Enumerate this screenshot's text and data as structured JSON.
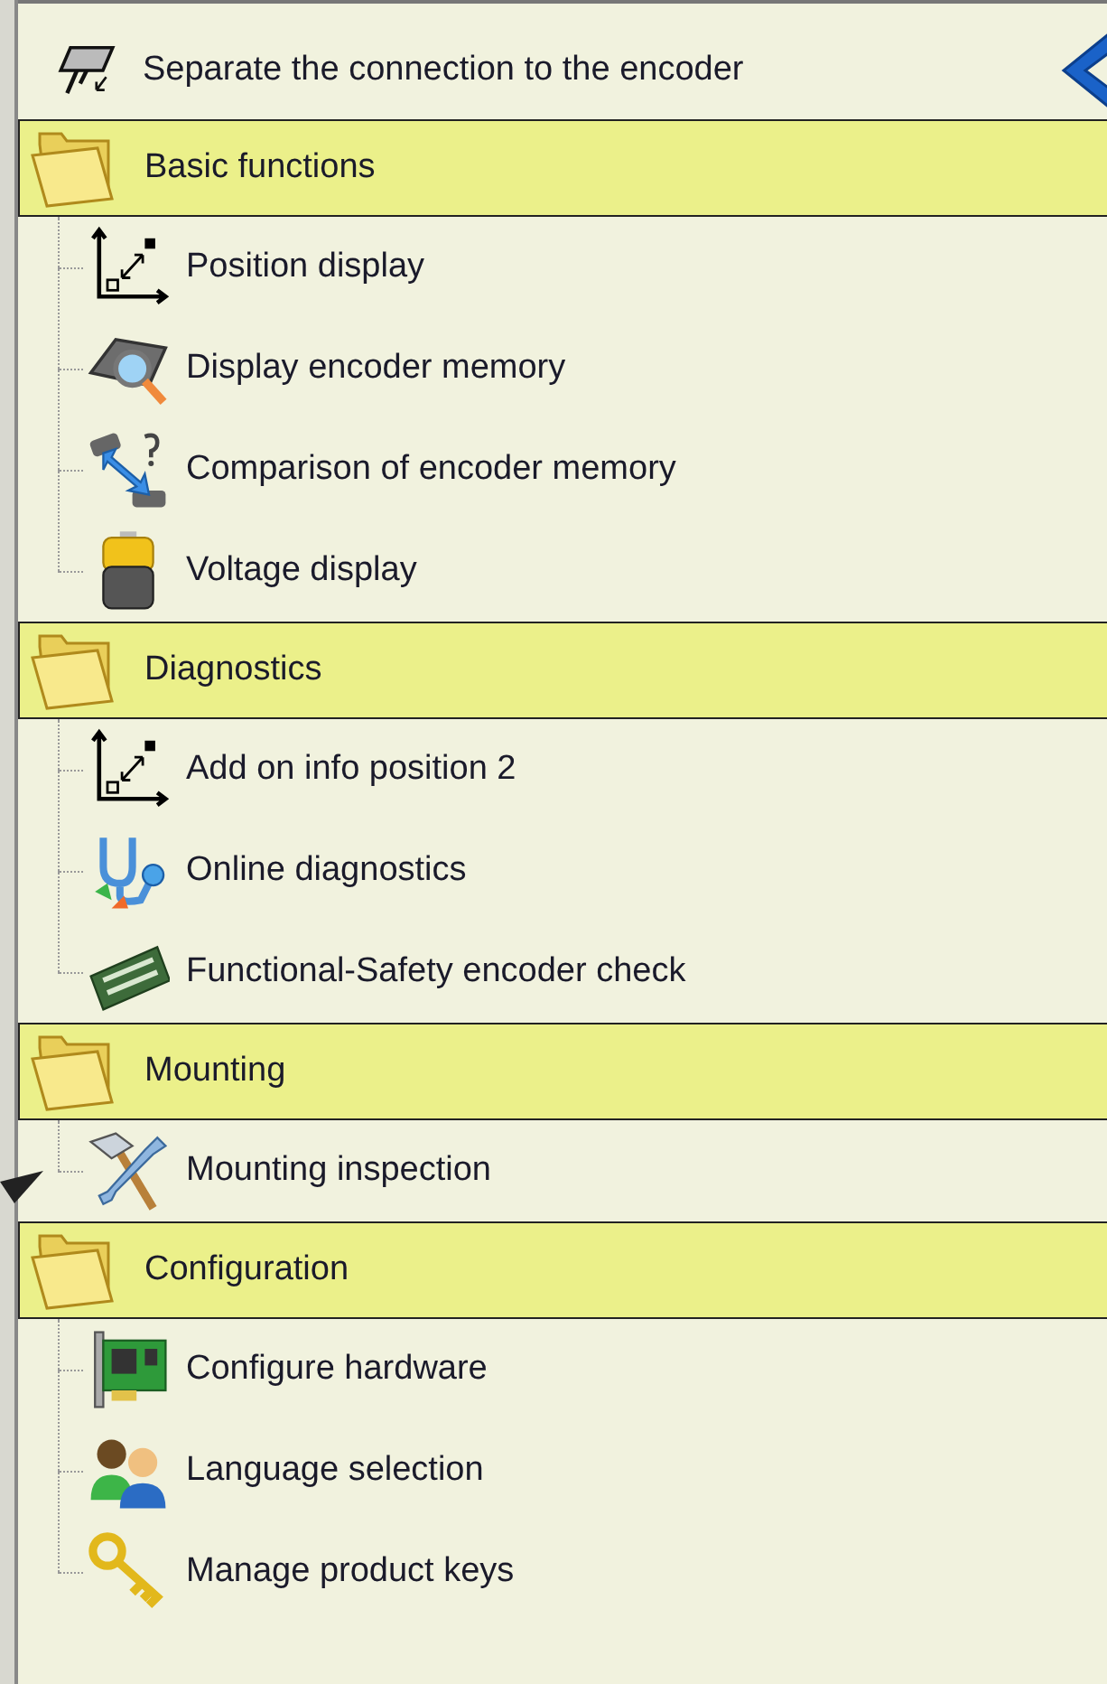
{
  "top_action": {
    "label": "Separate the connection to the encoder"
  },
  "groups": [
    {
      "title": "Basic functions",
      "items": [
        {
          "label": "Position display"
        },
        {
          "label": "Display encoder memory"
        },
        {
          "label": "Comparison of encoder memory"
        },
        {
          "label": "Voltage display"
        }
      ]
    },
    {
      "title": "Diagnostics",
      "items": [
        {
          "label": "Add on info position 2"
        },
        {
          "label": "Online diagnostics"
        },
        {
          "label": "Functional-Safety encoder check"
        }
      ]
    },
    {
      "title": "Mounting",
      "items": [
        {
          "label": "Mounting inspection"
        }
      ]
    },
    {
      "title": "Configuration",
      "items": [
        {
          "label": "Configure hardware"
        },
        {
          "label": "Language selection"
        },
        {
          "label": "Manage product keys"
        }
      ]
    }
  ]
}
